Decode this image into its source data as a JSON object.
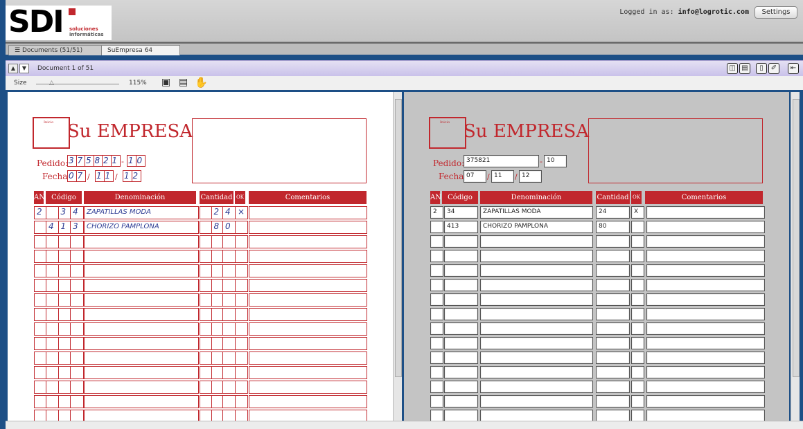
{
  "header": {
    "logo_text": "SDI",
    "logo_sub1": "soluciones",
    "logo_sub2": "informáticas",
    "logged_in_label": "Logged in as:",
    "user_email": "info@logrotic.com",
    "settings_label": "Settings"
  },
  "tabs": [
    {
      "label": "Documents (51/51)"
    },
    {
      "label": "SuEmpresa 64"
    }
  ],
  "nav": {
    "doc_counter": "Document 1 of 51"
  },
  "size": {
    "label": "Size",
    "zoom": "115%",
    "slider_fraction": 0.2
  },
  "form": {
    "title": "Su EMPRESA",
    "inicio_label": "Inicio",
    "pedido_label": "Pedido:",
    "fecha_label": "Fecha:",
    "pedido_digits": [
      "3",
      "7",
      "5",
      "8",
      "2",
      "1"
    ],
    "pedido_suffix": [
      "1",
      "0"
    ],
    "fecha_day": [
      "0",
      "7"
    ],
    "fecha_month": [
      "1",
      "1"
    ],
    "fecha_year": [
      "1",
      "2"
    ],
    "columns": [
      "AN",
      "Código",
      "Denominación",
      "Cantidad",
      "OK",
      "Comentarios"
    ],
    "rows": [
      {
        "an": "2",
        "codigo": "34",
        "codigo_hand": [
          "",
          "3",
          "4"
        ],
        "denominacion": "ZAPATILLAS MODA",
        "cantidad": "24",
        "cantidad_hand": [
          "",
          "2",
          "4"
        ],
        "ok": "X",
        "comentarios": ""
      },
      {
        "an": "",
        "codigo": "413",
        "codigo_hand": [
          "4",
          "1",
          "3"
        ],
        "denominacion": "CHORIZO PAMPLONA",
        "cantidad": "80",
        "cantidad_hand": [
          "",
          "8",
          "0"
        ],
        "ok": "",
        "comentarios": ""
      }
    ]
  },
  "extracted": {
    "pedido": "375821",
    "pedido_suffix": "10",
    "fecha_day": "07",
    "fecha_month": "11",
    "fecha_year": "12",
    "left_separator": "/",
    "dash": "-"
  },
  "hand_rows": {
    "row1_denominacion": "ZAPATILLAS  MODA",
    "row2_denominacion": "CHORIZO  PAMPLONA"
  }
}
